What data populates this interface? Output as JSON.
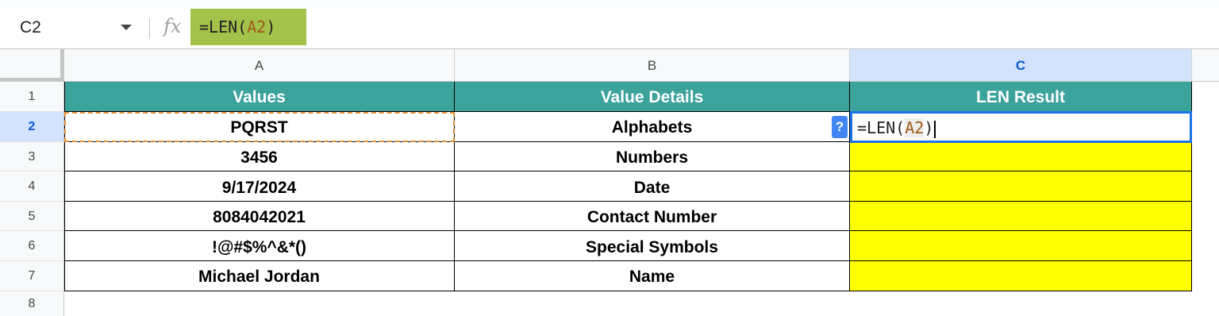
{
  "name_box": {
    "value": "C2"
  },
  "formula_bar": {
    "fx_label": "fx",
    "formula_prefix": "=LEN(",
    "formula_ref": "A2",
    "formula_suffix": ")"
  },
  "columns": [
    "A",
    "B",
    "C"
  ],
  "rows": [
    "1",
    "2",
    "3",
    "4",
    "5",
    "6",
    "7",
    "8"
  ],
  "table": {
    "headers": [
      "Values",
      "Value Details",
      "LEN Result"
    ],
    "body": [
      [
        "PQRST",
        "Alphabets",
        ""
      ],
      [
        "3456",
        "Numbers",
        ""
      ],
      [
        "9/17/2024",
        "Date",
        ""
      ],
      [
        "8084042021",
        "Contact Number",
        ""
      ],
      [
        "!@#$%^&*()",
        "Special Symbols",
        ""
      ],
      [
        "Michael Jordan",
        "Name",
        ""
      ]
    ]
  },
  "active_cell": {
    "formula_prefix": "=LEN(",
    "formula_ref": "A2",
    "formula_suffix": ")"
  },
  "help_badge": "?",
  "colors": {
    "header_fill": "#3ba29c",
    "result_fill": "#ffff00",
    "formula_highlight": "#a3c24a",
    "active_border": "#1a73e8",
    "copy_marquee": "#e69138"
  }
}
